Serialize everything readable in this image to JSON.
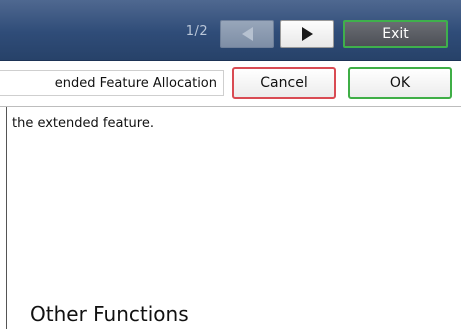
{
  "header": {
    "page_indicator": "1/2",
    "prev_icon": "triangle-left-icon",
    "next_icon": "triangle-right-icon",
    "exit_label": "Exit"
  },
  "dialog": {
    "title": "ended Feature Allocation",
    "cancel_label": "Cancel",
    "ok_label": "OK",
    "message": "the extended feature."
  },
  "footer": {
    "label": "Other Functions"
  },
  "colors": {
    "header_bg": "#2f4c78",
    "cancel_border": "#d94b53",
    "ok_border": "#3fae46",
    "exit_border": "#3fb04c"
  }
}
